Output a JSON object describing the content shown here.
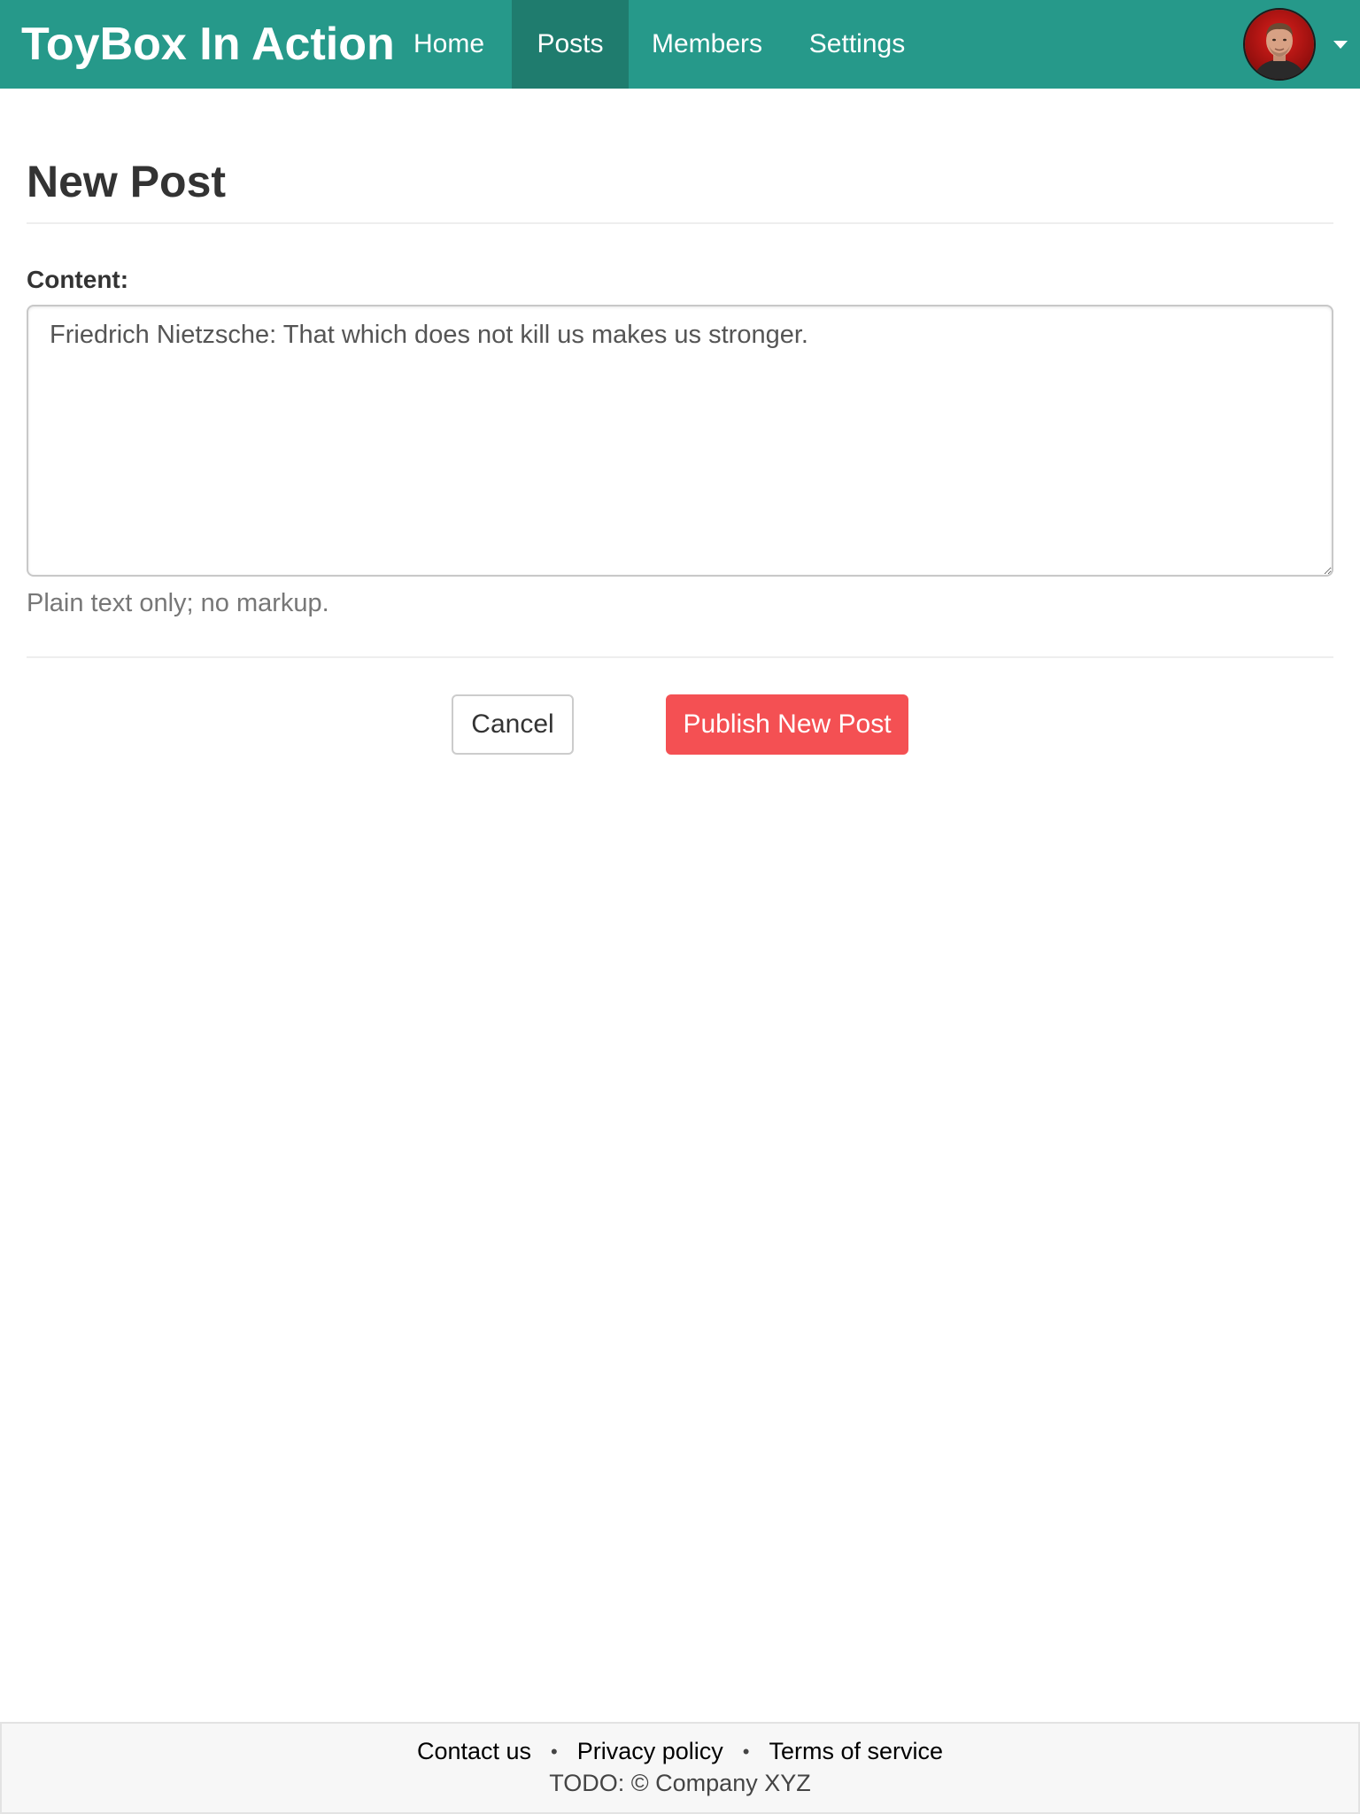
{
  "navbar": {
    "brand": "ToyBox In Action",
    "items": [
      {
        "label": "Home",
        "active": false
      },
      {
        "label": "Posts",
        "active": true
      },
      {
        "label": "Members",
        "active": false
      },
      {
        "label": "Settings",
        "active": false
      }
    ],
    "avatar_icon": "user-avatar-icon",
    "menu_icon": "caret-down-icon"
  },
  "page": {
    "title": "New Post"
  },
  "form": {
    "content_label": "Content:",
    "content_value": "Friedrich Nietzsche: That which does not kill us makes us stronger.",
    "help_text": "Plain text only; no markup.",
    "cancel_label": "Cancel",
    "publish_label": "Publish New Post"
  },
  "footer": {
    "links": [
      "Contact us",
      "Privacy policy",
      "Terms of service"
    ],
    "separator": "•",
    "copyright": "TODO: © Company XYZ"
  },
  "colors": {
    "navbar": "#26998a",
    "navbar_active": "#1f7c6e",
    "publish_button": "#f45053"
  }
}
